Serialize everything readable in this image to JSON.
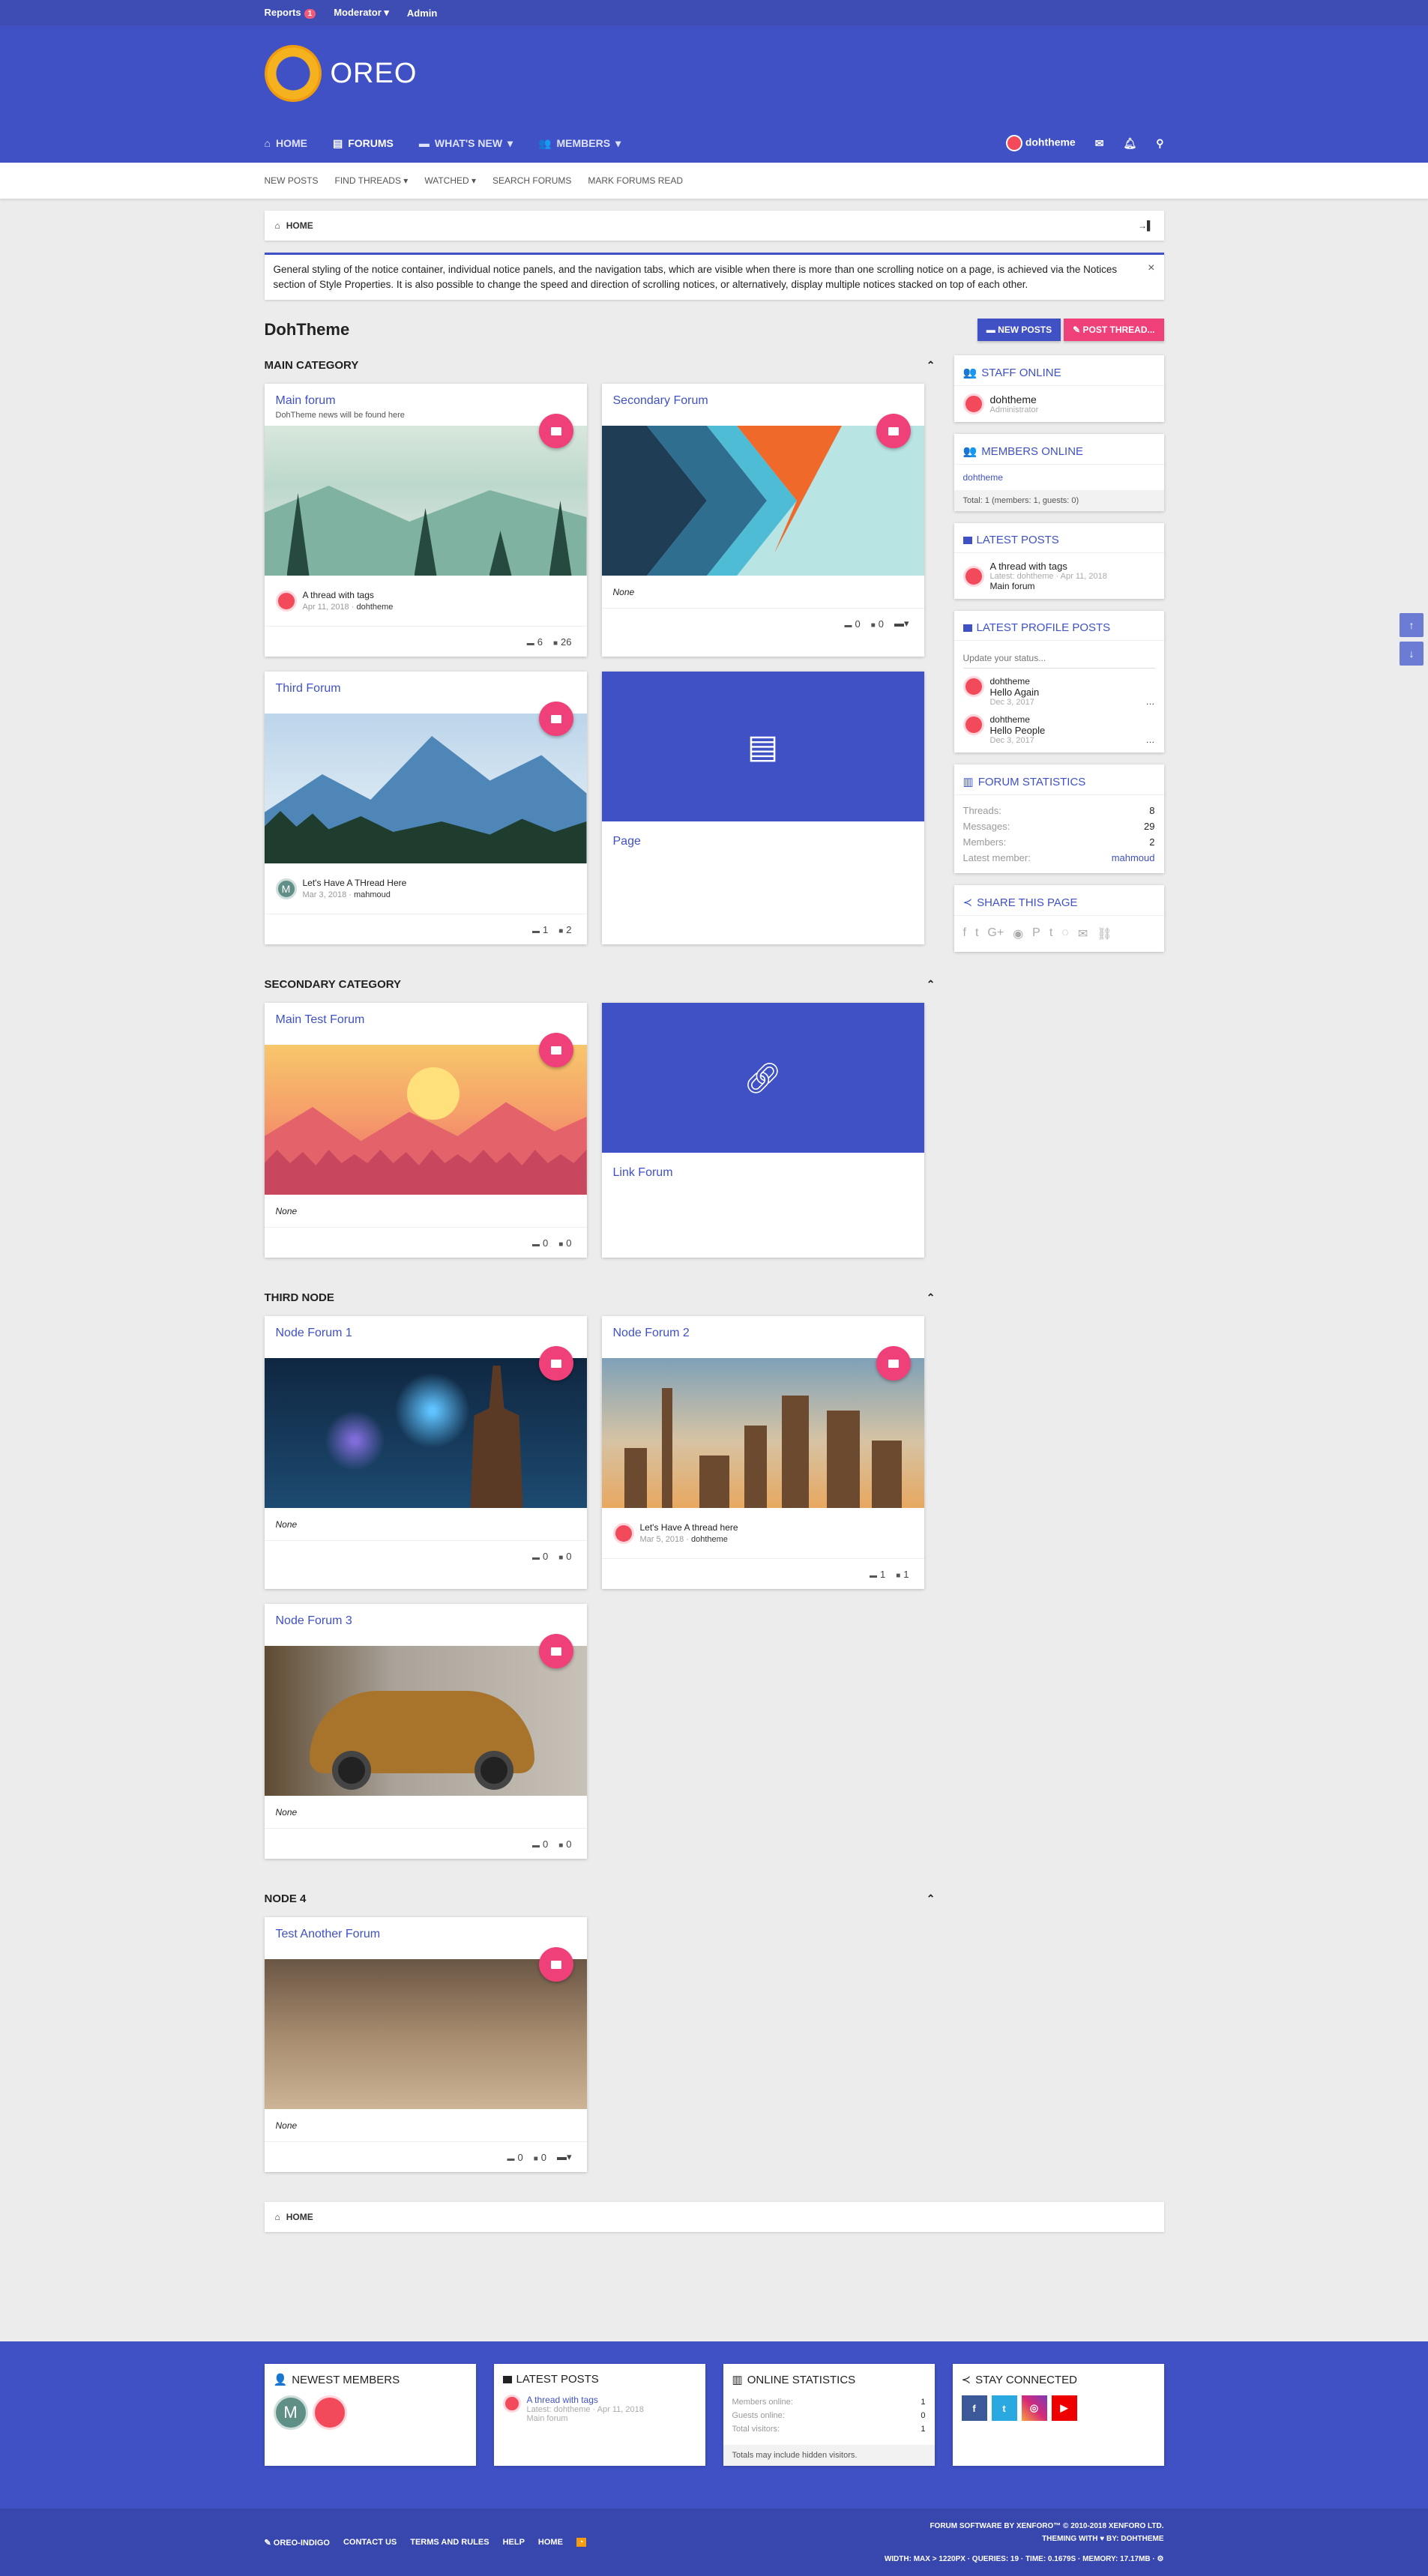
{
  "topbar": {
    "reports": "Reports",
    "reports_count": "1",
    "moderator": "Moderator",
    "admin": "Admin"
  },
  "logo": {
    "text": "OREO"
  },
  "nav": {
    "home": "HOME",
    "forums": "FORUMS",
    "whats_new": "WHAT'S NEW",
    "members": "MEMBERS",
    "user": "dohtheme"
  },
  "subnav": {
    "new_posts": "NEW POSTS",
    "find_threads": "FIND THREADS",
    "watched": "WATCHED",
    "search_forums": "SEARCH FORUMS",
    "mark_read": "MARK FORUMS READ"
  },
  "breadcrumb": {
    "home": "HOME"
  },
  "notice": {
    "text": "General styling of the notice container, individual notice panels, and the navigation tabs, which are visible when there is more than one scrolling notice on a page, is achieved via the Notices section of Style Properties. It is also possible to change the speed and direction of scrolling notices, or alternatively, display multiple notices stacked on top of each other.",
    "close": "×"
  },
  "page": {
    "title": "DohTheme",
    "new_posts_btn": "NEW POSTS",
    "post_thread_btn": "POST THREAD..."
  },
  "categories": {
    "main": "MAIN CATEGORY",
    "secondary": "SECONDARY CATEGORY",
    "third": "THIRD NODE",
    "node4": "NODE 4"
  },
  "forums": {
    "main_forum": {
      "title": "Main forum",
      "desc": "DohTheme news will be found here",
      "last_title": "A thread with tags",
      "last_date": "Apr 11, 2018",
      "last_user": "dohtheme",
      "threads": "6",
      "messages": "26"
    },
    "secondary_forum": {
      "title": "Secondary Forum",
      "last": "None",
      "threads": "0",
      "messages": "0"
    },
    "third_forum": {
      "title": "Third Forum",
      "last_title": "Let's Have A THread Here",
      "last_date": "Mar 3, 2018",
      "last_user": "mahmoud",
      "avatar_letter": "M",
      "threads": "1",
      "messages": "2"
    },
    "page": {
      "title": "Page"
    },
    "main_test": {
      "title": "Main Test Forum",
      "last": "None",
      "threads": "0",
      "messages": "0"
    },
    "link_forum": {
      "title": "Link Forum"
    },
    "node1": {
      "title": "Node Forum 1",
      "last": "None",
      "threads": "0",
      "messages": "0"
    },
    "node2": {
      "title": "Node Forum 2",
      "last_title": "Let's Have A thread here",
      "last_date": "Mar 5, 2018",
      "last_user": "dohtheme",
      "threads": "1",
      "messages": "1"
    },
    "node3": {
      "title": "Node Forum 3",
      "last": "None",
      "threads": "0",
      "messages": "0"
    },
    "test_another": {
      "title": "Test Another Forum",
      "last": "None",
      "threads": "0",
      "messages": "0"
    }
  },
  "sidebar": {
    "staff": {
      "title": "STAFF ONLINE",
      "name": "dohtheme",
      "role": "Administrator"
    },
    "members": {
      "title": "MEMBERS ONLINE",
      "name": "dohtheme",
      "total": "Total: 1 (members: 1, guests: 0)"
    },
    "latest_posts": {
      "title": "LATEST POSTS",
      "post_title": "A thread with tags",
      "meta": "Latest: dohtheme · Apr 11, 2018",
      "forum": "Main forum"
    },
    "profile_posts": {
      "title": "LATEST PROFILE POSTS",
      "placeholder": "Update your status...",
      "items": [
        {
          "user": "dohtheme",
          "text": "Hello Again",
          "date": "Dec 3, 2017"
        },
        {
          "user": "dohtheme",
          "text": "Hello People",
          "date": "Dec 3, 2017"
        }
      ]
    },
    "stats": {
      "title": "FORUM STATISTICS",
      "threads_k": "Threads:",
      "threads_v": "8",
      "messages_k": "Messages:",
      "messages_v": "29",
      "members_k": "Members:",
      "members_v": "2",
      "latest_k": "Latest member:",
      "latest_v": "mahmoud"
    },
    "share": {
      "title": "SHARE THIS PAGE"
    }
  },
  "footer": {
    "newest": {
      "title": "NEWEST MEMBERS",
      "letter": "M"
    },
    "latest": {
      "title": "LATEST POSTS",
      "post_title": "A thread with tags",
      "meta": "Latest: dohtheme · Apr 11, 2018",
      "forum": "Main forum"
    },
    "online": {
      "title": "ONLINE STATISTICS",
      "members_k": "Members online:",
      "members_v": "1",
      "guests_k": "Guests online:",
      "guests_v": "0",
      "total_k": "Total visitors:",
      "total_v": "1",
      "note": "Totals may include hidden visitors."
    },
    "connect": {
      "title": "STAY CONNECTED",
      "fb": "f",
      "tw": "t",
      "ig": "◎",
      "yt": "▶"
    },
    "links": {
      "style": "OREO-INDIGO",
      "contact": "CONTACT US",
      "terms": "TERMS AND RULES",
      "help": "HELP",
      "home": "HOME"
    },
    "copyright": "FORUM SOFTWARE BY XENFORO™ © 2010-2018 XENFORO LTD.",
    "theming": "THEMING WITH ♥ BY: DOHTHEME",
    "debug": "WIDTH: MAX > 1220PX · QUERIES: 19 · TIME: 0.1679S · MEMORY: 17.17MB · ⚙"
  },
  "colors": {
    "primary": "#3f51c5",
    "accent": "#f0407a"
  }
}
